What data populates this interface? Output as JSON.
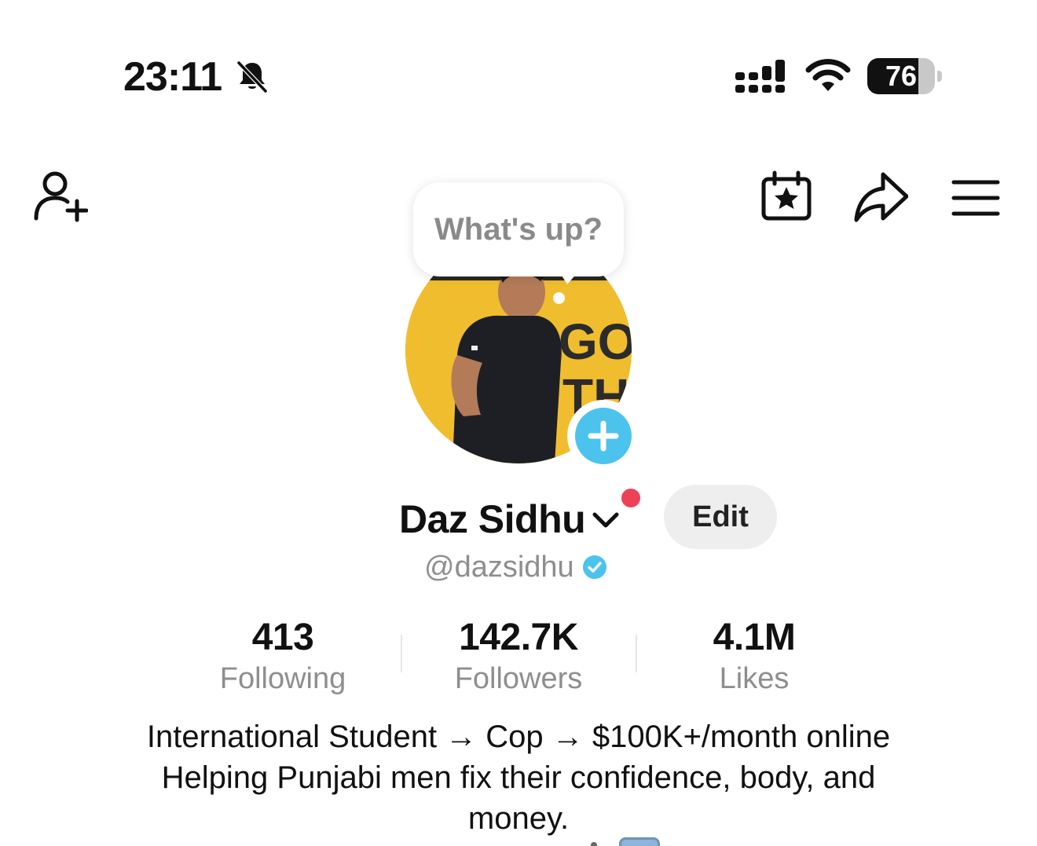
{
  "status_bar": {
    "time": "23:11",
    "battery_level": "76",
    "battery_fraction": 0.76,
    "icons": [
      "bell-slash-icon",
      "cellular-signal-icon",
      "wifi-icon",
      "battery-icon"
    ]
  },
  "top_nav": {
    "icons": [
      "add-friend-icon",
      "calendar-star-icon",
      "share-icon",
      "menu-icon"
    ]
  },
  "bubble": {
    "text": "What's up?"
  },
  "profile": {
    "name": "Daz Sidhu",
    "handle": "@dazsidhu",
    "verified": true,
    "edit_label": "Edit",
    "accent_color": "#4cc3ec",
    "notification_color": "#ef4155"
  },
  "stats": [
    {
      "value": "413",
      "label": "Following"
    },
    {
      "value": "142.7K",
      "label": "Followers"
    },
    {
      "value": "4.1M",
      "label": "Likes"
    }
  ],
  "bio": {
    "lines": [
      "International Student → Cop → $100K+/month online",
      "Helping Punjabi men fix their confidence, body, and",
      "money."
    ]
  }
}
